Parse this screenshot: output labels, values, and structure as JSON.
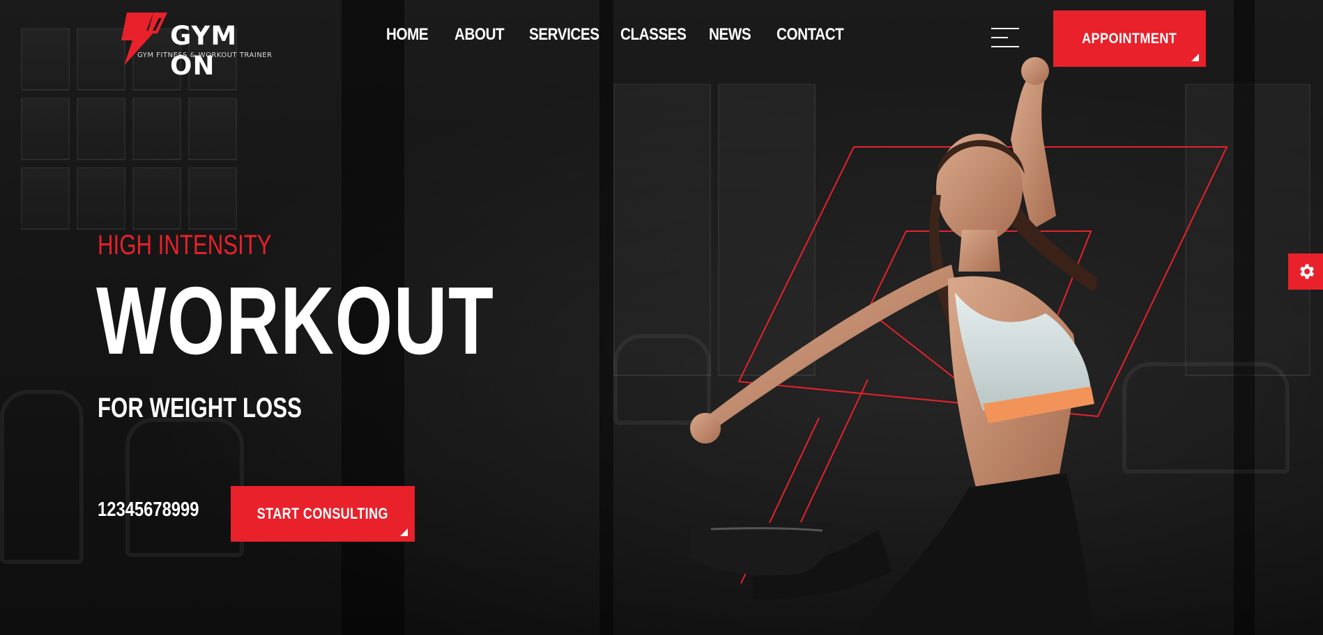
{
  "brand": {
    "name": "GYM ON",
    "tagline": "GYM FITNESS & WORKOUT TRAINER",
    "accent": "#e8212b"
  },
  "nav": {
    "items": [
      "HOME",
      "ABOUT",
      "SERVICES",
      "CLASSES",
      "NEWS",
      "CONTACT"
    ]
  },
  "header": {
    "menu_icon": "hamburger-menu-icon",
    "appointment_label": "APPOINTMENT"
  },
  "hero": {
    "pre_title": "HIGH INTENSITY",
    "title": "WORKOUT",
    "subtitle": "FOR WEIGHT LOSS",
    "phone": "12345678999",
    "cta_label": "START CONSULTING"
  },
  "settings": {
    "icon": "gear-icon"
  }
}
